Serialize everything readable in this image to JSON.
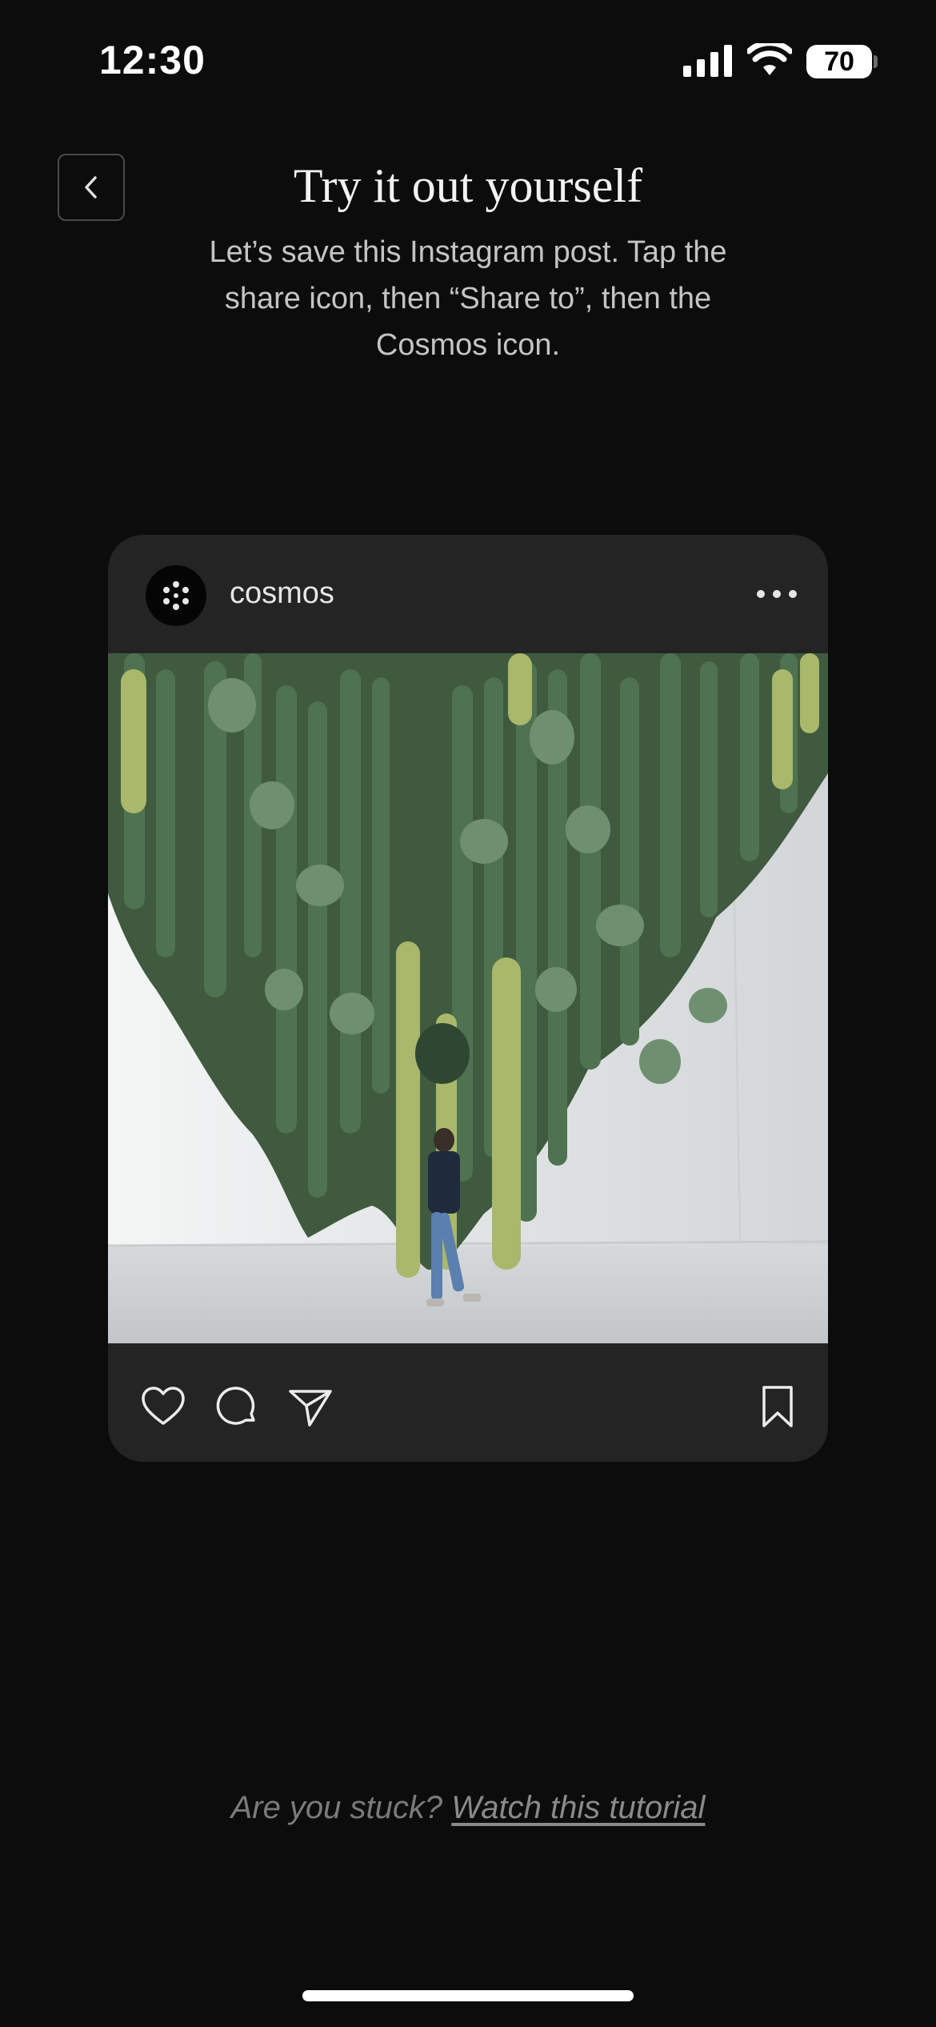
{
  "status_bar": {
    "time": "12:30",
    "battery": "70",
    "icons": [
      "signal-icon",
      "wifi-icon",
      "battery-icon"
    ]
  },
  "header": {
    "back_icon": "chevron-left-icon",
    "title": "Try it out yourself",
    "subtitle": "Let’s save this Instagram post. Tap the share icon, then “Share to”, then the Cosmos icon."
  },
  "post": {
    "username": "cosmos",
    "avatar_icon": "cosmos-dots-logo",
    "more_icon": "more-horizontal-icon",
    "image_alt": "photo-cacti-hanging-from-ceiling",
    "actions": [
      "heart-icon",
      "comment-icon",
      "share-send-icon",
      "bookmark-icon"
    ]
  },
  "footer": {
    "stuck_text": "Are you stuck?",
    "tutorial_link": "Watch this tutorial"
  },
  "colors": {
    "background": "#0c0c0c",
    "card": "#242424",
    "text_primary": "#f2f2f2",
    "text_secondary": "#c4c4c4",
    "text_muted": "#7a7a7a"
  }
}
